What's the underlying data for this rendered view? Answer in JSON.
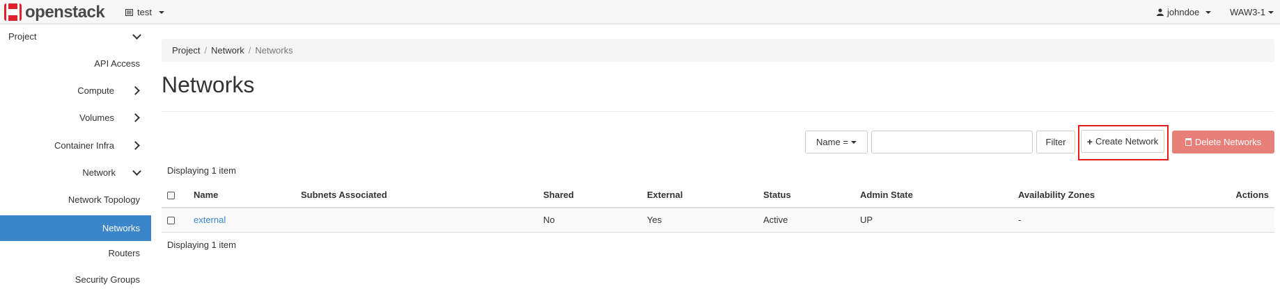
{
  "topbar": {
    "brand": "openstack",
    "project": "test",
    "user": "johndoe",
    "region": "WAW3-1"
  },
  "sidebar": {
    "items": [
      {
        "label": "Project",
        "icon": "chevron-down-icon"
      },
      {
        "label": "API Access"
      },
      {
        "label": "Compute",
        "icon": "chevron-right-icon"
      },
      {
        "label": "Volumes",
        "icon": "chevron-right-icon"
      },
      {
        "label": "Container Infra",
        "icon": "chevron-right-icon"
      },
      {
        "label": "Network",
        "icon": "chevron-down-icon"
      },
      {
        "label": "Network Topology"
      },
      {
        "label": "Networks",
        "active": true
      },
      {
        "label": "Routers"
      },
      {
        "label": "Security Groups"
      }
    ]
  },
  "breadcrumb": [
    "Project",
    "Network",
    "Networks"
  ],
  "page_title": "Networks",
  "filter": {
    "field": "Name =",
    "value": "",
    "button": "Filter"
  },
  "actions": {
    "create": "Create Network",
    "delete": "Delete Networks"
  },
  "display_count": "Displaying 1 item",
  "table": {
    "columns": [
      "Name",
      "Subnets Associated",
      "Shared",
      "External",
      "Status",
      "Admin State",
      "Availability Zones",
      "Actions"
    ],
    "rows": [
      {
        "name": "external",
        "subnets": "",
        "shared": "No",
        "external": "Yes",
        "status": "Active",
        "admin_state": "UP",
        "zones": "-",
        "actions": ""
      }
    ]
  },
  "colors": {
    "accent": "#3b86c8",
    "danger": "#e8807a",
    "highlight": "#e41b1b",
    "brand": "#e0202a"
  }
}
